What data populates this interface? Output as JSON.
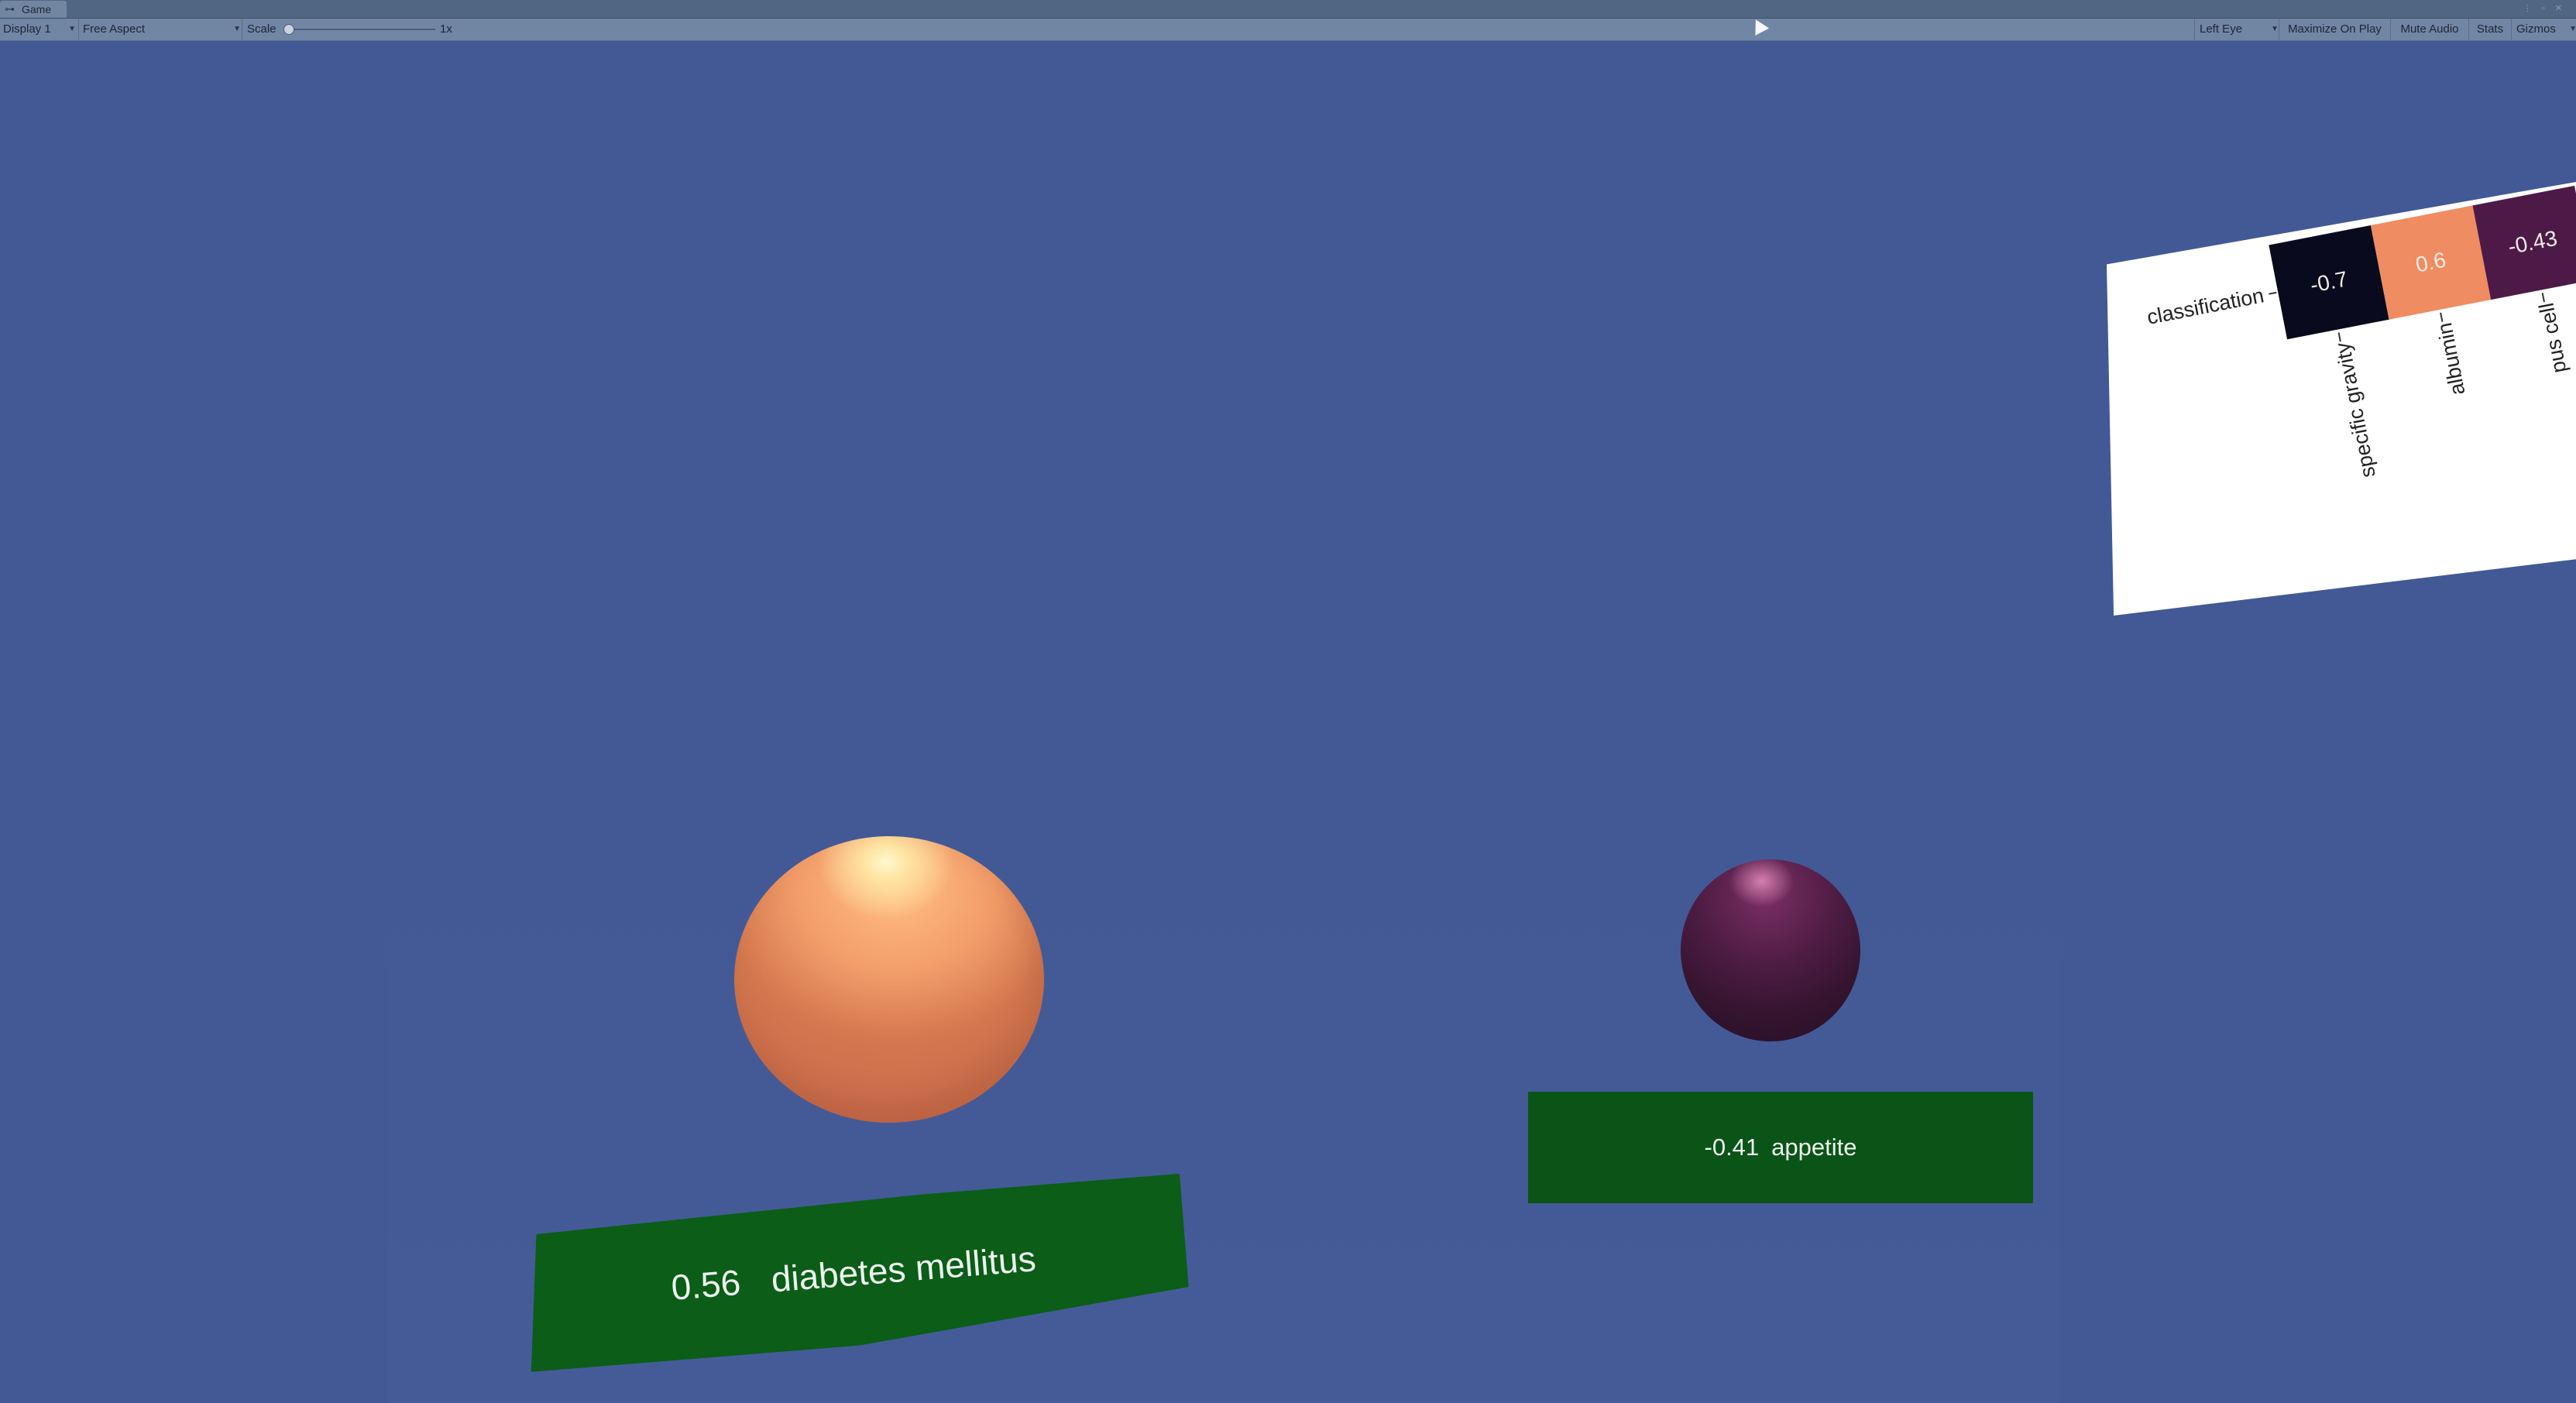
{
  "window": {
    "tab_label": "Game",
    "tab_icon": "gamepad-icon",
    "controls": [
      "⋮",
      "▫",
      "✕"
    ]
  },
  "toolbar": {
    "display": "Display 1",
    "aspect": "Free Aspect",
    "scale_label": "Scale",
    "scale_value": "1x",
    "scale_level": 0.0,
    "eye": "Left Eye",
    "maximize": "Maximize On Play",
    "mute": "Mute Audio",
    "stats": "Stats",
    "gizmos": "Gizmos"
  },
  "scene": {
    "colors": {
      "background": "#435995",
      "positive_sphere": "#f39d6a",
      "negative_sphere": "#4e1c44",
      "label_board": "#0b5d17"
    },
    "spheres": [
      {
        "name": "diabetes mellitus",
        "value": "0.56",
        "color": "orange"
      },
      {
        "name": "appetite",
        "value": "-0.41",
        "color": "purple"
      }
    ],
    "boards": {
      "diabetes": {
        "value": "0.56",
        "label": "diabetes mellitus"
      },
      "appetite": {
        "value": "-0.41",
        "label": "appetite"
      }
    },
    "heatmap": {
      "row_label": "classification",
      "columns": [
        {
          "label": "specific gravity",
          "value": "-0.7",
          "color": "#0a0a1e"
        },
        {
          "label": "albumin",
          "value": "0.6",
          "color": "#f08c62"
        },
        {
          "label": "pus cell",
          "value": "-0.43",
          "color": "#4d1a47"
        }
      ]
    }
  }
}
